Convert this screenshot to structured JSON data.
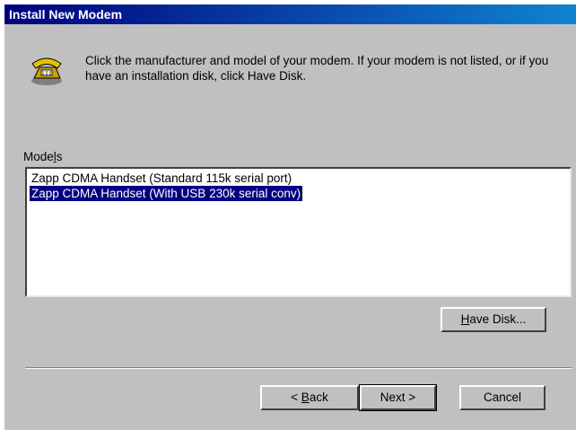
{
  "window": {
    "title": "Install New Modem"
  },
  "header": {
    "icon": "telephone-modem-icon",
    "instruction": "Click the manufacturer and model of your modem. If your modem is not listed, or if you have an installation disk, click Have Disk."
  },
  "models": {
    "label_pre": "Mode",
    "label_ul": "l",
    "label_post": "s",
    "items": [
      {
        "label": "Zapp CDMA Handset (Standard 115k serial port)",
        "selected": false
      },
      {
        "label": "Zapp CDMA Handset (With USB 230k serial conv)",
        "selected": true
      }
    ]
  },
  "buttons": {
    "have_disk": {
      "ul": "H",
      "rest": "ave Disk..."
    },
    "back": {
      "pre": "< ",
      "ul": "B",
      "rest": "ack"
    },
    "next": "Next >",
    "cancel": "Cancel"
  }
}
